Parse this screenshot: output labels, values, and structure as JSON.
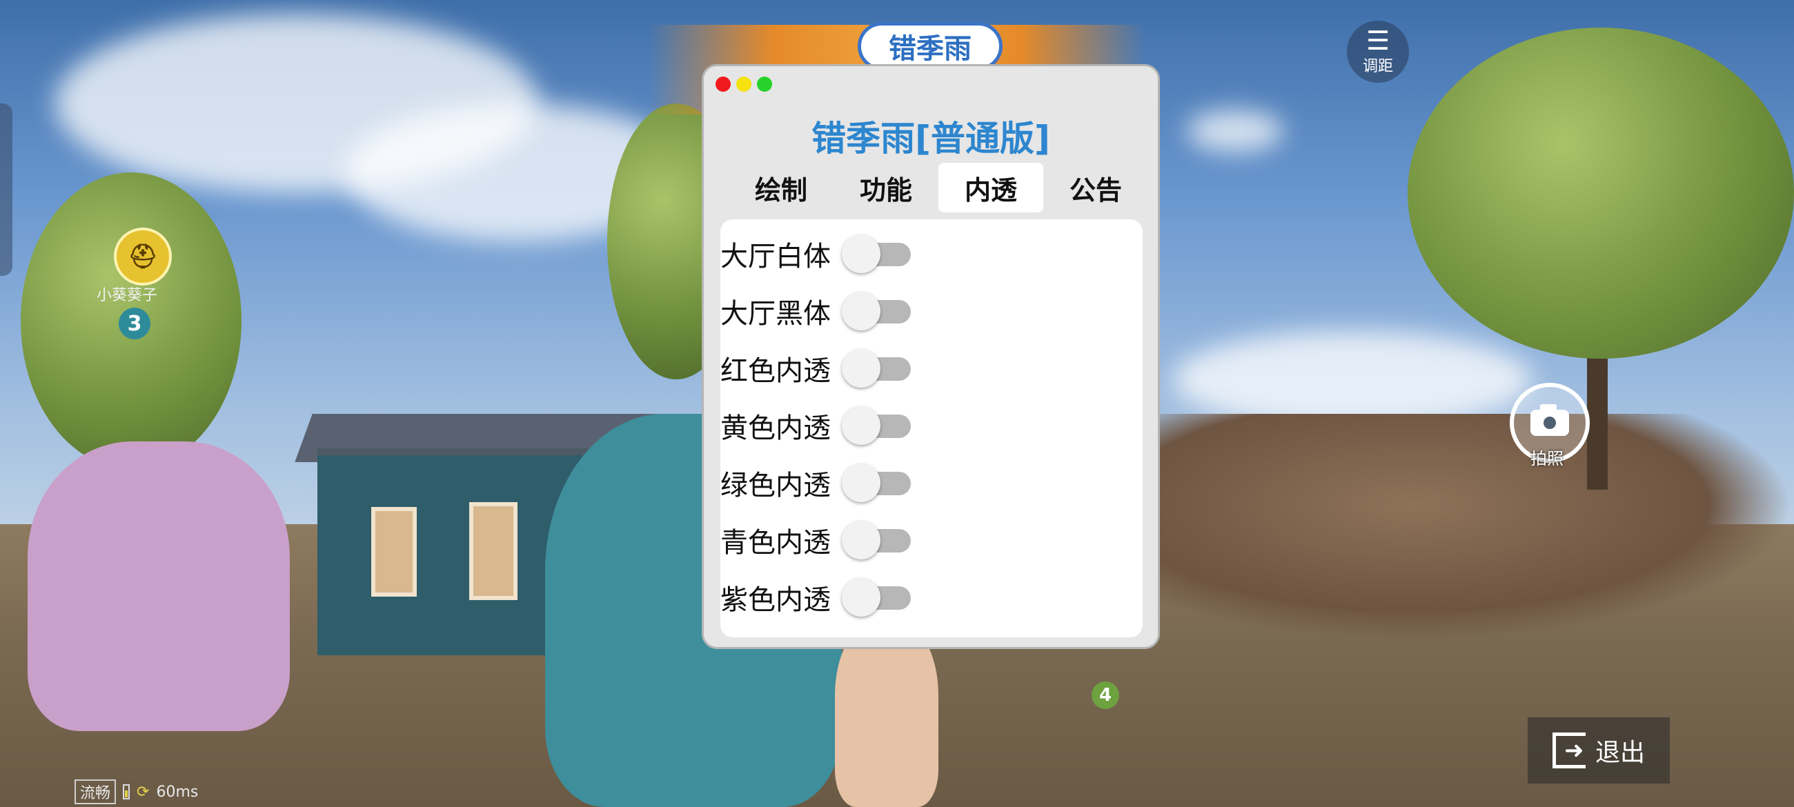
{
  "banner": {
    "title": "错季雨"
  },
  "hud": {
    "team_badge_icon": "helmet-icon",
    "team_member_name": "小葵葵子",
    "team_number": "3",
    "range_label": "调距",
    "photo_label": "拍照",
    "exit_label": "退出",
    "teammate_marker": "4",
    "status": {
      "quality": "流畅",
      "ping": "60ms"
    }
  },
  "panel": {
    "title": "错季雨[普通版]",
    "window_dots": [
      "#f2191e",
      "#f5e20f",
      "#28d22c"
    ],
    "tabs": [
      {
        "label": "绘制",
        "active": false
      },
      {
        "label": "功能",
        "active": false
      },
      {
        "label": "内透",
        "active": true
      },
      {
        "label": "公告",
        "active": false
      }
    ],
    "toggles": [
      {
        "label": "大厅白体",
        "on": false
      },
      {
        "label": "大厅黑体",
        "on": false
      },
      {
        "label": "红色内透",
        "on": false
      },
      {
        "label": "黄色内透",
        "on": false
      },
      {
        "label": "绿色内透",
        "on": false
      },
      {
        "label": "青色内透",
        "on": false
      },
      {
        "label": "紫色内透",
        "on": false
      }
    ],
    "accent_color": "#2d86cf"
  }
}
